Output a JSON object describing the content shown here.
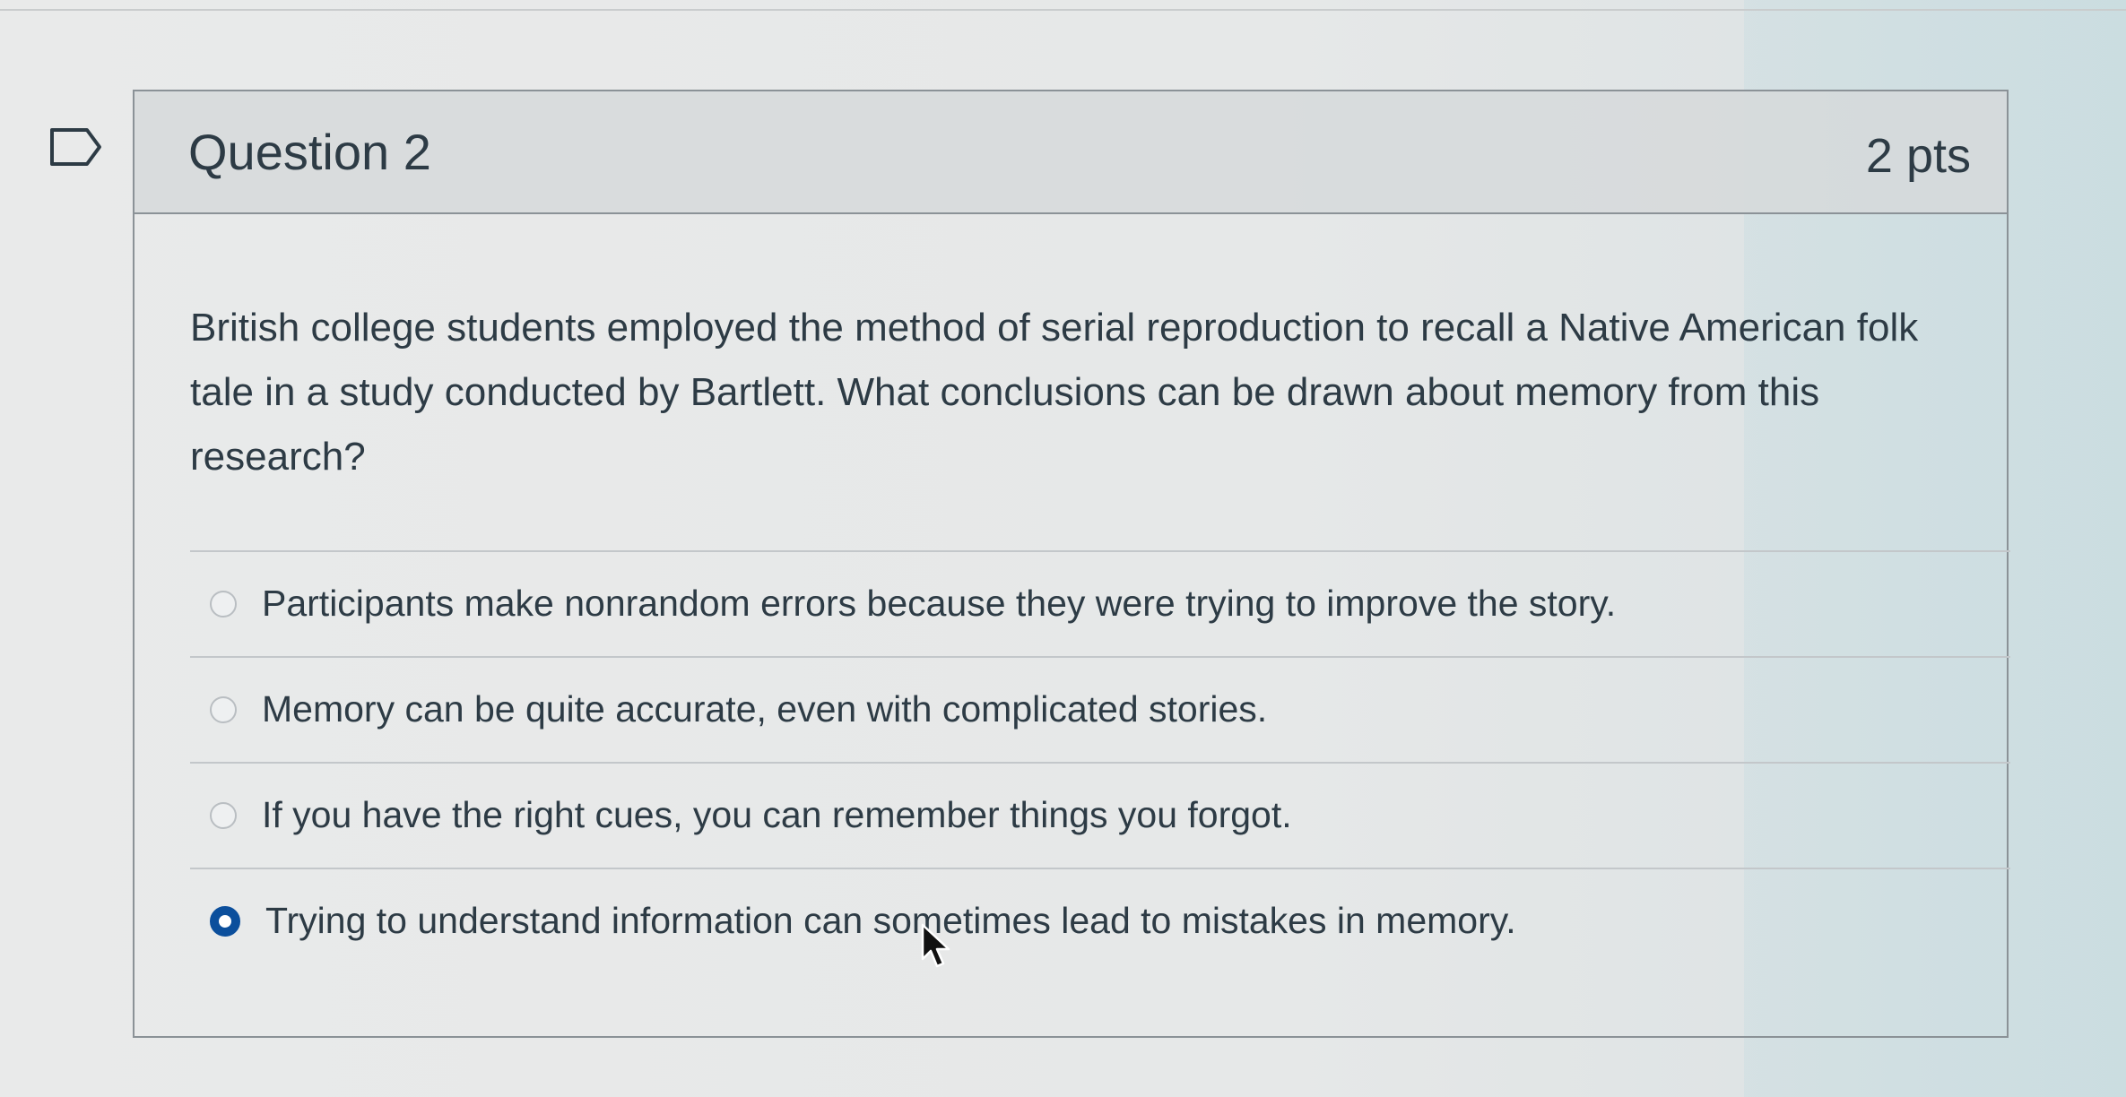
{
  "question": {
    "title": "Question 2",
    "points": "2 pts",
    "text": "British college students employed the method of serial reproduction to recall a Native American folk tale in a study conducted by Bartlett. What conclusions can be drawn about memory from this research?",
    "answers": [
      {
        "label": "Participants make nonrandom errors because they were trying to improve the story.",
        "selected": false
      },
      {
        "label": "Memory can be quite accurate, even with complicated stories.",
        "selected": false
      },
      {
        "label": "If you have the right cues, you can remember things you forgot.",
        "selected": false
      },
      {
        "label": "Trying to understand information can sometimes lead to mistakes in memory.",
        "selected": true
      }
    ]
  },
  "colors": {
    "selected_radio": "#0b4f9c",
    "text": "#2d3b45",
    "border": "#8b9297"
  },
  "icons": {
    "flag": "bookmark-flag-icon",
    "cursor": "mouse-pointer-icon"
  }
}
